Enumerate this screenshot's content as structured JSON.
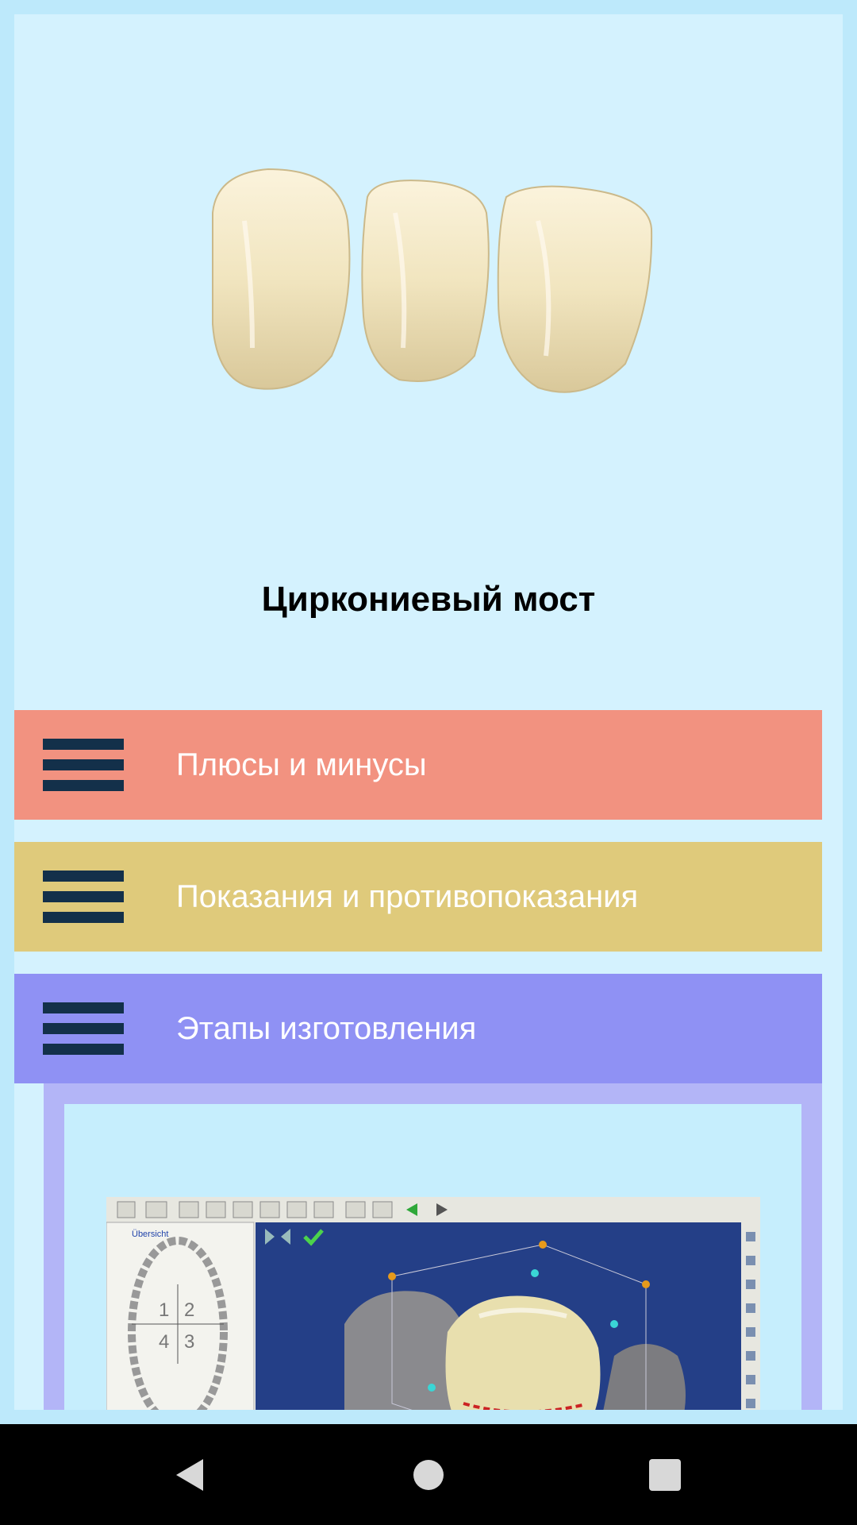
{
  "article": {
    "title": "Циркониевый мост",
    "hero_image": "zirconia-bridge-photo"
  },
  "menu": [
    {
      "label": "Плюсы и минусы",
      "icon": "hamburger-icon",
      "color": "#f29280"
    },
    {
      "label": "Показания и противопоказания",
      "icon": "hamburger-icon",
      "color": "#dfca7b"
    },
    {
      "label": "Этапы изготовления",
      "icon": "hamburger-icon",
      "color": "#8f91f4",
      "expanded": true
    }
  ],
  "expanded_section": {
    "image": "cad-software-screenshot",
    "quadrant_labels": [
      "1",
      "2",
      "4",
      "3"
    ],
    "tab_label": "Übersicht"
  },
  "colors": {
    "background": "#bde9fb",
    "card": "#d4f2fe",
    "menu_icon": "#13304a",
    "expanded_border": "#b3b5f7"
  },
  "system_nav": {
    "back": "back-icon",
    "home": "home-icon",
    "recents": "recents-icon"
  }
}
